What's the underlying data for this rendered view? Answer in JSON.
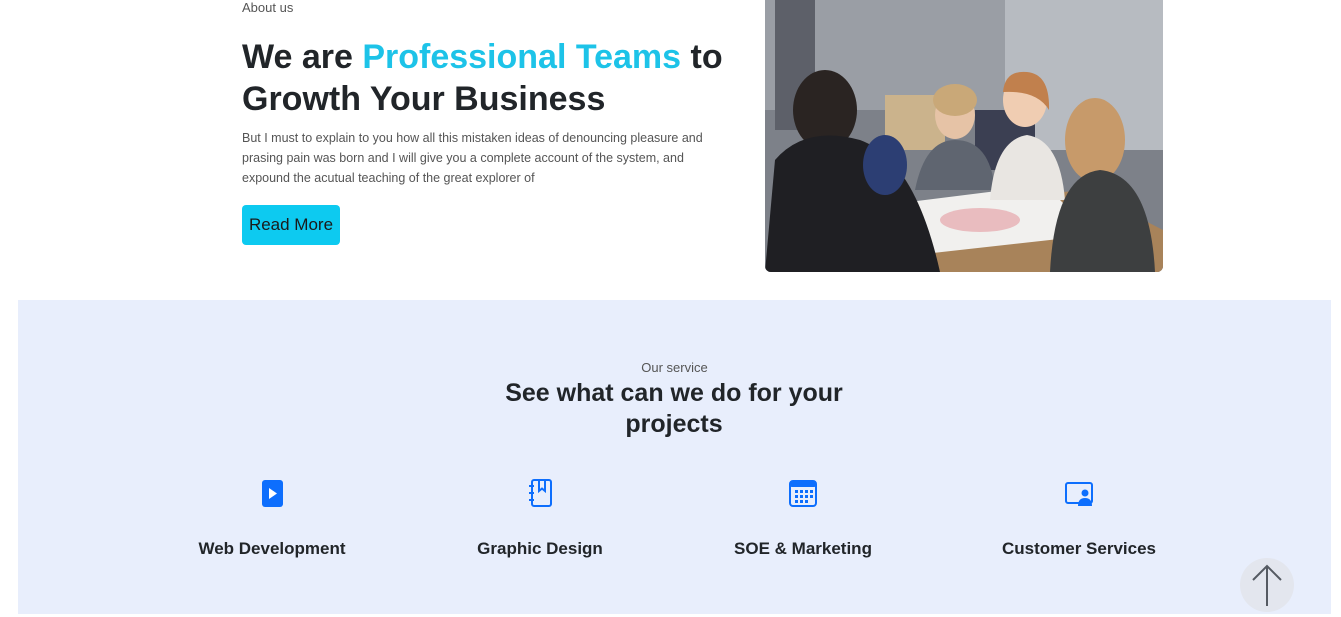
{
  "about": {
    "kicker": "About us",
    "title_prefix": "We are ",
    "title_accent": "Professional Teams",
    "title_suffix": " to Growth Your Business",
    "body": "But I must to explain to you how all this mistaken ideas of denouncing pleasure and prasing pain was born and I will give you a complete account of the system, and expound the acutual teaching of the great explorer of",
    "read_more_label": "Read More",
    "accent_color": "#1dc3e8",
    "button_color": "#0dcaf0"
  },
  "services": {
    "kicker": "Our service",
    "title": "See what can we do for your projects",
    "background": "#e8eefc",
    "icon_color": "#0d6efd",
    "items": [
      {
        "label": "Web Development",
        "icon": "play-box-icon"
      },
      {
        "label": "Graphic Design",
        "icon": "bookmark-notebook-icon"
      },
      {
        "label": "SOE & Marketing",
        "icon": "calendar-icon"
      },
      {
        "label": "Customer Services",
        "icon": "person-screen-icon"
      }
    ]
  },
  "scroll_top": {
    "icon": "arrow-up-icon"
  }
}
